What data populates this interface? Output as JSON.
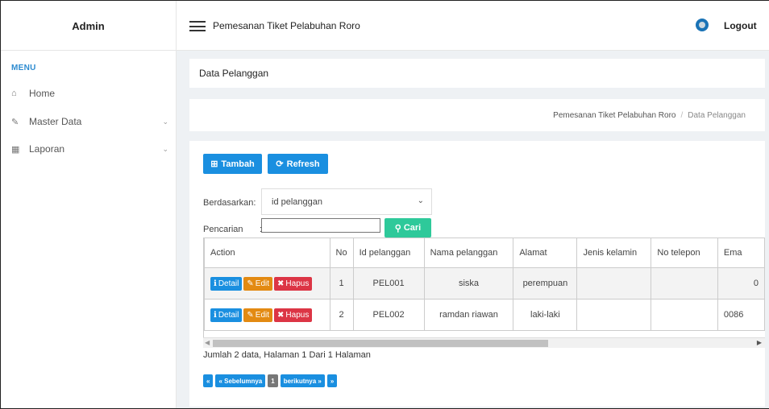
{
  "header": {
    "brand": "Admin",
    "app_title": "Pemesanan Tiket Pelabuhan Roro",
    "logout_label": "Logout"
  },
  "sidebar": {
    "menu_header": "MENU",
    "items": [
      {
        "label": "Home",
        "icon": "home-icon"
      },
      {
        "label": "Master Data",
        "icon": "edit-icon"
      },
      {
        "label": "Laporan",
        "icon": "calendar-icon"
      }
    ]
  },
  "page": {
    "heading": "Data Pelanggan",
    "breadcrumb": [
      "Pemesanan Tiket Pelabuhan Roro",
      "Data Pelanggan"
    ]
  },
  "toolbar": {
    "add_label": "Tambah",
    "refresh_label": "Refresh"
  },
  "filter": {
    "by_label": "Berdasarkan:",
    "selected": "id pelanggan",
    "search_label": "Pencarian",
    "search_colon": ":",
    "search_value": "",
    "search_button": "Cari"
  },
  "table": {
    "columns": [
      "Action",
      "No",
      "Id pelanggan",
      "Nama pelanggan",
      "Alamat",
      "Jenis kelamin",
      "No telepon",
      "Ema"
    ],
    "action_labels": {
      "detail": "Detail",
      "edit": "Edit",
      "delete": "Hapus"
    },
    "rows": [
      {
        "no": "1",
        "id": "PEL001",
        "nama": "siska",
        "alamat": "perempuan",
        "jenis_kelamin": "",
        "no_telepon": "",
        "email": "0"
      },
      {
        "no": "2",
        "id": "PEL002",
        "nama": "ramdan riawan",
        "alamat": "laki-laki",
        "jenis_kelamin": "",
        "no_telepon": "",
        "email": "0086"
      }
    ]
  },
  "summary": "Jumlah 2 data, Halaman 1 Dari 1 Halaman",
  "pagination": {
    "first": "«",
    "prev": "« Sebelumnya",
    "current": "1",
    "next": "berikutnya »",
    "last": "»"
  },
  "colors": {
    "primary": "#1a8fe0",
    "success": "#2ec99a",
    "warning": "#e38a12",
    "danger": "#dc3545",
    "menu_header": "#2d8bd0"
  }
}
